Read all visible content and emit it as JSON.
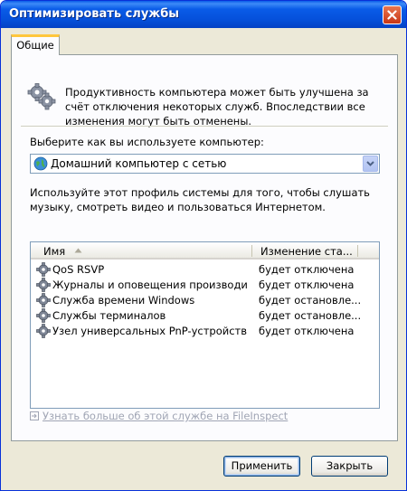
{
  "window": {
    "title": "Оптимизировать службы"
  },
  "tabs": [
    {
      "label": "Общие"
    }
  ],
  "intro_text": "Продуктивность компьютера может быть улучшена за счёт отключения некоторых служб. Впоследствии все изменения могут быть отменены.",
  "select_label": "Выберите как вы используете компьютер:",
  "profile_select": {
    "value": "Домашний компьютер с сетью",
    "icon": "network-globe-icon"
  },
  "profile_description": "Используйте этот профиль системы для того, чтобы слушать музыку, смотреть видео и пользоваться Интернетом.",
  "table": {
    "columns": [
      "Имя",
      "Изменение ста..."
    ],
    "rows": [
      {
        "name": "QoS RSVP",
        "status": "будет отключена"
      },
      {
        "name": "Журналы и оповещения производит...",
        "status": "будет отключена"
      },
      {
        "name": "Служба времени Windows",
        "status": "будет остановле..."
      },
      {
        "name": "Службы терминалов",
        "status": "будет остановле..."
      },
      {
        "name": "Узел универсальных PnP-устройств",
        "status": "будет отключена"
      }
    ]
  },
  "link_text": "Узнать больше об этой службе на FileInspect",
  "buttons": {
    "apply": "Применить",
    "close": "Закрыть"
  },
  "colors": {
    "titlebar": "#0A5CE8",
    "tab_accent": "#FFC73C",
    "window_bg": "#ECE9D8",
    "link_disabled": "#A0A5B4"
  }
}
